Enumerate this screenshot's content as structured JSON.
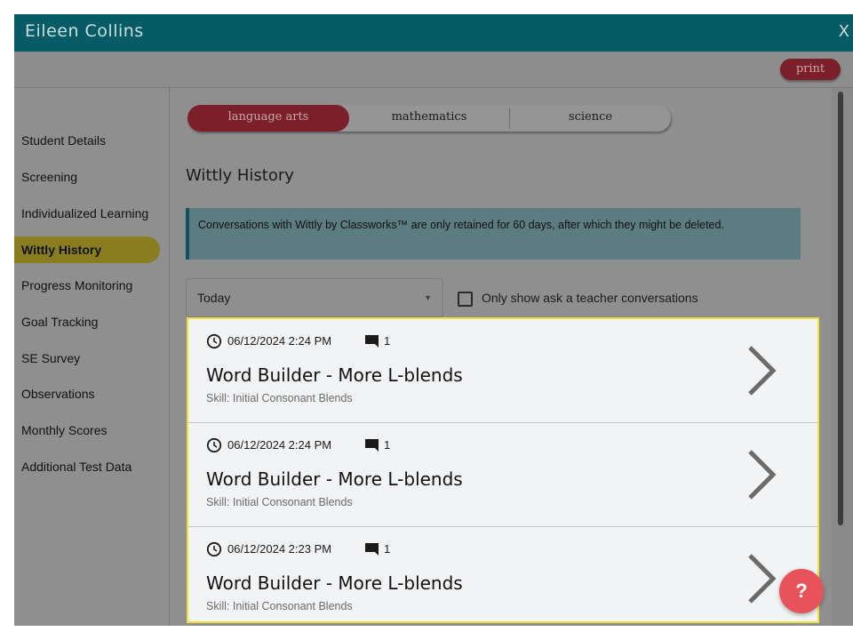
{
  "window": {
    "title": "Eileen Collins",
    "close_label": "X"
  },
  "toolbar": {
    "print_label": "print"
  },
  "sidebar": {
    "items": [
      {
        "label": "Student Details"
      },
      {
        "label": "Screening"
      },
      {
        "label": "Individualized Learning"
      },
      {
        "label": "Wittly History",
        "active": true
      },
      {
        "label": "Progress Monitoring"
      },
      {
        "label": "Goal Tracking"
      },
      {
        "label": "SE Survey"
      },
      {
        "label": "Observations"
      },
      {
        "label": "Monthly Scores"
      },
      {
        "label": "Additional Test Data"
      }
    ]
  },
  "subject_tabs": [
    {
      "label": "language arts",
      "active": true
    },
    {
      "label": "mathematics"
    },
    {
      "label": "science"
    }
  ],
  "main": {
    "heading": "Wittly History",
    "notice": "Conversations with Wittly by Classworks™ are only retained for 60 days, after which they might be deleted.",
    "filter": {
      "selected": "Today"
    },
    "checkbox": {
      "label": "Only show ask a teacher conversations",
      "checked": false
    }
  },
  "conversations": [
    {
      "datetime": "06/12/2024 2:24 PM",
      "message_count": "1",
      "title": "Word Builder - More L-blends",
      "skill": "Skill: Initial Consonant Blends"
    },
    {
      "datetime": "06/12/2024 2:24 PM",
      "message_count": "1",
      "title": "Word Builder - More L-blends",
      "skill": "Skill: Initial Consonant Blends"
    },
    {
      "datetime": "06/12/2024 2:23 PM",
      "message_count": "1",
      "title": "Word Builder - More L-blends",
      "skill": "Skill: Initial Consonant Blends"
    }
  ],
  "help": {
    "label": "?"
  },
  "icons": [
    "clock-icon",
    "chat-icon",
    "chevron-right-icon",
    "dropdown-arrow-icon",
    "close-icon"
  ],
  "colors": {
    "titlebar": "#075b66",
    "active_tab": "#7b1f2b",
    "active_sidebar": "#8a7d1f",
    "highlight_border": "#f1df3e",
    "help_button": "#e8525b"
  }
}
